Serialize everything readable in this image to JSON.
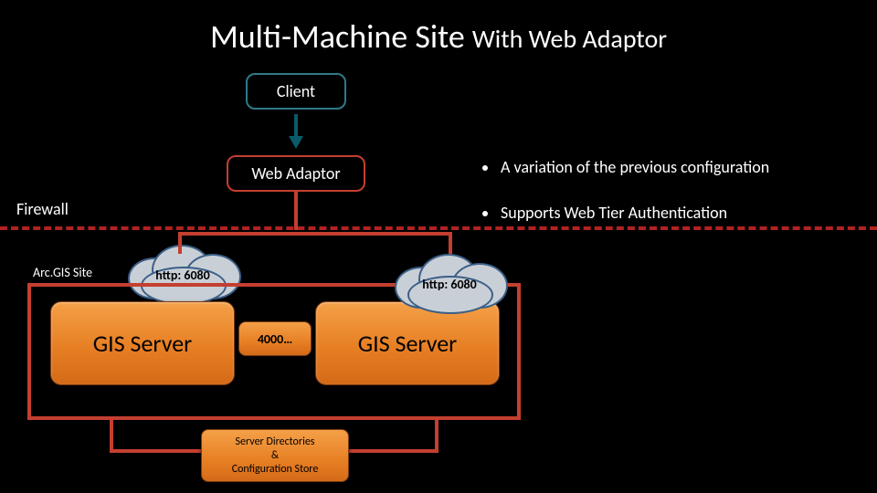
{
  "title": {
    "main": "Multi-Machine Site ",
    "sub": "With Web Adaptor"
  },
  "nodes": {
    "client": "Client",
    "web_adaptor": "Web Adaptor",
    "gis_server_a": "GIS Server",
    "gis_server_b": "GIS Server",
    "port_badge": "4000…",
    "directories": "Server Directories\n&\nConfiguration Store"
  },
  "labels": {
    "firewall": "Firewall",
    "site": "Arc.GIS Site",
    "http_a": "http: 6080",
    "http_b": "http: 6080"
  },
  "bullets": [
    "A variation of the previous configuration",
    "Supports Web Tier Authentication"
  ],
  "colors": {
    "background": "#000000",
    "client_border": "#2e7a8a",
    "adaptor_border": "#c43f2f",
    "firewall_dash": "#b22222",
    "server_fill": "#e77f24",
    "cloud_fill": "#c9cfd6",
    "cloud_border": "#3b5f87"
  }
}
